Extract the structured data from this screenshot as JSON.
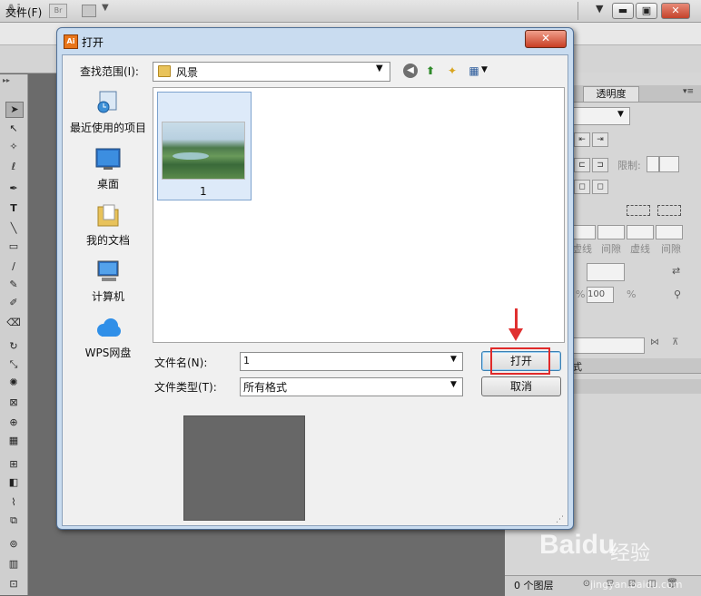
{
  "app": {
    "logo": "Ai",
    "bridge_label": "Br",
    "menu": {
      "file": "文件(F)"
    }
  },
  "right_panel": {
    "tab_label": "透明度",
    "limit_label": "限制:",
    "dashed_labels": [
      "虚线",
      "间隙",
      "虚线",
      "间隙"
    ],
    "percent_value": "100",
    "percent_sign": "%",
    "panel2_tab": "式",
    "layers_count": "0 个图层"
  },
  "dialog": {
    "title": "打开",
    "close_label": "✕",
    "look_in_label": "查找范围(I):",
    "look_in_value": "风景",
    "places": [
      {
        "label": "最近使用的项目",
        "icon": "recent-items-icon"
      },
      {
        "label": "桌面",
        "icon": "desktop-icon"
      },
      {
        "label": "我的文档",
        "icon": "documents-icon"
      },
      {
        "label": "计算机",
        "icon": "computer-icon"
      },
      {
        "label": "WPS网盘",
        "icon": "cloud-icon"
      }
    ],
    "files": [
      {
        "name": "1",
        "type": "image"
      }
    ],
    "filename_label": "文件名(N):",
    "filename_value": "1",
    "filetype_label": "文件类型(T):",
    "filetype_value": "所有格式",
    "open_button": "打开",
    "cancel_button": "取消"
  },
  "watermark": {
    "brand": "Baidu",
    "product": "经验",
    "url": "jingyan.baidu.com"
  },
  "colors": {
    "highlight": "#e02a2a",
    "dialog_frame": "#c9dcf0",
    "canvas": "#6b6b6b"
  }
}
